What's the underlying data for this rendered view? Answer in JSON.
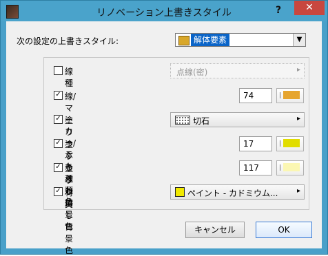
{
  "window": {
    "title": "リノベーション上書きスタイル",
    "help_label": "?",
    "close_label": "✕"
  },
  "top": {
    "label": "次の設定の上書きスタイル:",
    "selected": "解体要素"
  },
  "options": [
    {
      "label": "線種",
      "checked": false,
      "value": "点線(密)"
    },
    {
      "label": "線/マーカー/テキスト色",
      "checked": true,
      "number": "74",
      "color": "#e6a52f"
    },
    {
      "label": "塗りつぶし種類",
      "checked": true,
      "value": "切石"
    },
    {
      "label": "塗りつぶし前景色",
      "checked": true,
      "number": "17",
      "color": "#e1dd00"
    },
    {
      "label": "塗りつぶし背景色",
      "checked": true,
      "number": "117",
      "color": "#fbf7b3"
    },
    {
      "label": "材質",
      "checked": true,
      "value": "ペイント - カドミウム..."
    }
  ],
  "buttons": {
    "cancel": "キャンセル",
    "ok": "OK"
  }
}
